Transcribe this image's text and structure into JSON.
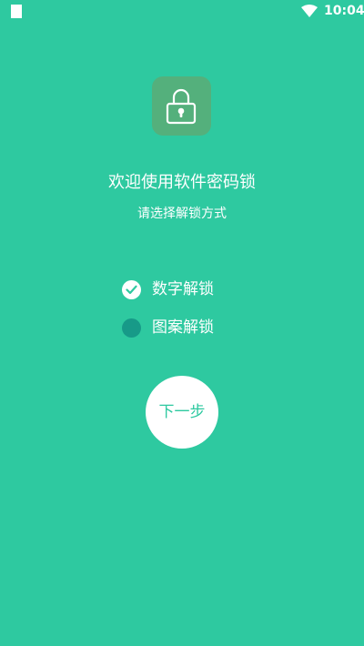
{
  "status_bar": {
    "time": "10:04",
    "left_icon": "sim-card-icon",
    "wifi_icon": "wifi-icon"
  },
  "app_icon": "padlock-icon",
  "title": "欢迎使用软件密码锁",
  "subtitle": "请选择解锁方式",
  "options": [
    {
      "label": "数字解锁",
      "selected": true
    },
    {
      "label": "图案解锁",
      "selected": false
    }
  ],
  "next_button": {
    "label": "下一步"
  },
  "colors": {
    "background": "#2ec9a0",
    "icon_tile": "#54b07c",
    "unchecked_radio": "#179a88",
    "text": "#ffffff"
  }
}
